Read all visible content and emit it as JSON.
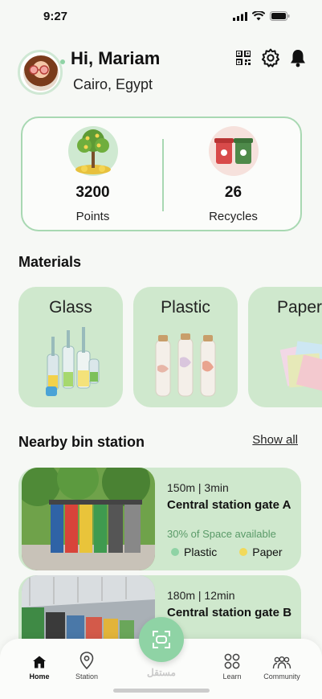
{
  "status_bar": {
    "time": "9:27"
  },
  "header": {
    "greeting": "Hi, Mariam",
    "location": "Cairo, Egypt",
    "icons": [
      "qr-code-icon",
      "gear-icon",
      "bell-icon"
    ]
  },
  "stats": {
    "points": {
      "value": "3200",
      "label": "Points"
    },
    "recycles": {
      "value": "26",
      "label": "Recycles"
    }
  },
  "materials": {
    "title": "Materials",
    "items": [
      {
        "name": "Glass"
      },
      {
        "name": "Plastic"
      },
      {
        "name": "Paper"
      }
    ]
  },
  "nearby": {
    "title": "Nearby bin station",
    "show_all": "Show all",
    "stations": [
      {
        "meta": "150m | 3min",
        "name": "Central station gate A",
        "space": "30% of Space available",
        "tags": [
          {
            "label": "Plastic",
            "color": "#8fd3a5"
          },
          {
            "label": "Paper",
            "color": "#f1d95a"
          }
        ]
      },
      {
        "meta": "180m | 12min",
        "name": "Central station gate B"
      }
    ]
  },
  "nav": {
    "home": "Home",
    "station": "Station",
    "learn": "Learn",
    "community": "Community"
  },
  "watermark": "مستقل"
}
